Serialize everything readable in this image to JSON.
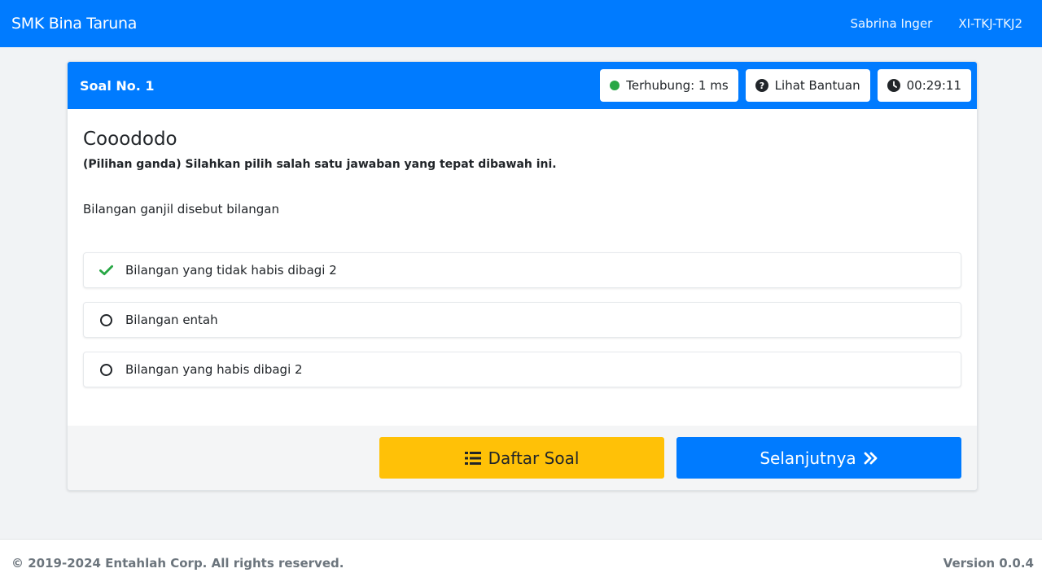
{
  "navbar": {
    "brand": "SMK Bina Taruna",
    "user_name": "Sabrina Inger",
    "class_name": "XI-TKJ-TKJ2"
  },
  "card": {
    "title": "Soal No. 1",
    "tools": {
      "connection": "Terhubung: 1 ms",
      "help": "Lihat Bantuan",
      "timer": "00:29:11"
    },
    "question_title": "Cooododo",
    "instruction": "(Pilihan ganda) Silahkan pilih salah satu jawaban yang tepat dibawah ini.",
    "question_text": "Bilangan ganjil disebut bilangan",
    "options": [
      {
        "label": "Bilangan yang tidak habis dibagi 2",
        "selected": true
      },
      {
        "label": "Bilangan entah",
        "selected": false
      },
      {
        "label": "Bilangan yang habis dibagi 2",
        "selected": false
      }
    ],
    "footer": {
      "list_button": "Daftar Soal",
      "next_button": "Selanjutnya"
    }
  },
  "footer": {
    "copyright": "© 2019-2024 Entahlah Corp. All rights reserved.",
    "version": "Version 0.0.4"
  },
  "colors": {
    "primary": "#007bff",
    "warning": "#ffc107",
    "success": "#28a745"
  },
  "icons": {
    "connection": "status-dot-icon",
    "help": "question-circle-icon",
    "timer": "clock-icon",
    "selected_option": "check-icon",
    "unselected_option": "circle-icon",
    "list_button": "list-icon",
    "next_button": "double-chevron-right-icon"
  }
}
